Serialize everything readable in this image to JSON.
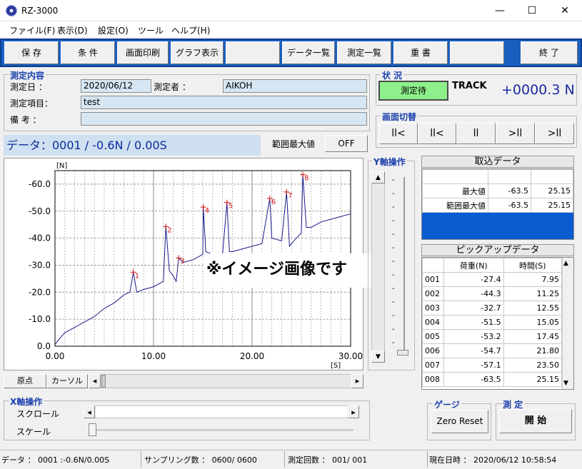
{
  "window": {
    "title": "RZ-3000",
    "minimize": "—",
    "maximize": "☐",
    "close": "✕"
  },
  "menu": [
    "ファイル(F)",
    "表示(D)",
    "設定(O)",
    "ツール",
    "ヘルプ(H)"
  ],
  "toolbar": [
    "保 存",
    "条 件",
    "画面印刷",
    "グラフ表示",
    "",
    "データ一覧",
    "測定一覧",
    "重 書",
    "",
    "終 了"
  ],
  "measure": {
    "title": "測定内容",
    "date_label": "測定日 ：",
    "date": "2020/06/12",
    "operator_label": "測定者 ：",
    "operator": "AIKOH",
    "item_label": "測定項目：",
    "item": "test",
    "remark_label": "備 考 ：",
    "remark": ""
  },
  "status": {
    "title": "状 況",
    "state": "測定待",
    "mode": "TRACK",
    "value": "+0000.3 N"
  },
  "screen_switch": {
    "title": "画面切替",
    "buttons": [
      "ll<",
      "ll<",
      "ll",
      ">ll",
      ">ll"
    ]
  },
  "data_line": "データ：0001 / -0.6N / 0.00S",
  "range_max": {
    "label": "範囲最大値",
    "toggle": "OFF"
  },
  "y_axis_op": "Y軸操作",
  "overlay_text": "※イメージ画像です",
  "chart_data": {
    "type": "line",
    "ylabel": "[N]",
    "xlabel": "[S]",
    "xlim": [
      0,
      30
    ],
    "ylim": [
      0,
      -65
    ],
    "xticks": [
      "0.00",
      "10.00",
      "20.00",
      "30.00"
    ],
    "yticks": [
      "0.0",
      "-10.0",
      "-20.0",
      "-30.0",
      "-40.0",
      "-50.0",
      "-60.0"
    ],
    "grid": true,
    "x": [
      0,
      0.5,
      1,
      2,
      3,
      4,
      5,
      6,
      7,
      7.6,
      7.95,
      8.3,
      9,
      10,
      11,
      11.25,
      11.6,
      12,
      12.3,
      12.55,
      13,
      14,
      15,
      15.05,
      15.3,
      16,
      17,
      17.45,
      17.7,
      18,
      19,
      20,
      21,
      21.8,
      22,
      23,
      23.5,
      23.8,
      24,
      25,
      25.15,
      25.5,
      26,
      27,
      28,
      29,
      30
    ],
    "y": [
      -0.6,
      -3,
      -5,
      -7,
      -9,
      -11,
      -14,
      -16,
      -19,
      -20,
      -27.4,
      -20,
      -21,
      -22,
      -24,
      -44.3,
      -28,
      -26,
      -24,
      -32.7,
      -31,
      -32,
      -34,
      -51.5,
      -35,
      -34,
      -34,
      -53.2,
      -35,
      -35,
      -36,
      -37,
      -38,
      -54.7,
      -40,
      -39,
      -57.1,
      -37,
      -38,
      -42,
      -63.5,
      -44,
      -44,
      -46,
      -47,
      -48,
      -49
    ],
    "peaks": [
      {
        "label": "1",
        "x": 7.95,
        "y": -27.4
      },
      {
        "label": "2",
        "x": 11.25,
        "y": -44.3
      },
      {
        "label": "3",
        "x": 12.55,
        "y": -32.7
      },
      {
        "label": "4",
        "x": 15.05,
        "y": -51.5
      },
      {
        "label": "5",
        "x": 17.45,
        "y": -53.2
      },
      {
        "label": "6",
        "x": 21.8,
        "y": -54.7
      },
      {
        "label": "7",
        "x": 23.5,
        "y": -57.1
      },
      {
        "label": "8",
        "x": 25.15,
        "y": -63.5
      }
    ],
    "colors": {
      "line": "#1a1a8c",
      "peak": "#d01010"
    }
  },
  "yslider": {
    "ticks": [
      "-",
      "-",
      "-",
      "-",
      "-",
      "-",
      "-",
      "-",
      "-",
      "-",
      "-",
      "-",
      "-"
    ]
  },
  "hbar": {
    "origin": "原点",
    "cursor": "カーソル",
    "left": "◂",
    "right": "▸"
  },
  "capture": {
    "title": "取込データ",
    "rows": [
      {
        "name": "",
        "load": "",
        "time": ""
      },
      {
        "name": "最大値",
        "load": "-63.5",
        "time": "25.15"
      },
      {
        "name": "範囲最大値",
        "load": "-63.5",
        "time": "25.15"
      }
    ]
  },
  "pickup": {
    "title": "ピックアップデータ",
    "headers": [
      "",
      "荷重(N)",
      "時間(S)"
    ],
    "rows": [
      [
        "001",
        "-27.4",
        "7.95"
      ],
      [
        "002",
        "-44.3",
        "11.25"
      ],
      [
        "003",
        "-32.7",
        "12.55"
      ],
      [
        "004",
        "-51.5",
        "15.05"
      ],
      [
        "005",
        "-53.2",
        "17.45"
      ],
      [
        "006",
        "-54.7",
        "21.80"
      ],
      [
        "007",
        "-57.1",
        "23.50"
      ],
      [
        "008",
        "-63.5",
        "25.15"
      ]
    ]
  },
  "xaxis_op": {
    "title": "X軸操作",
    "scroll": "スクロール",
    "scale": "スケール"
  },
  "gauge": {
    "title": "ゲージ",
    "button": "Zero Reset"
  },
  "measure_ctl": {
    "title": "測 定",
    "button": "開 始"
  },
  "statusbar": {
    "data": "データ ： 0001 :-0.6N/0.00S",
    "samples": "サンプリング数 ： 0600/ 0600",
    "count": "測定回数 ： 001/ 001",
    "time": "現在日時 ： 2020/06/12 10:58:54"
  }
}
